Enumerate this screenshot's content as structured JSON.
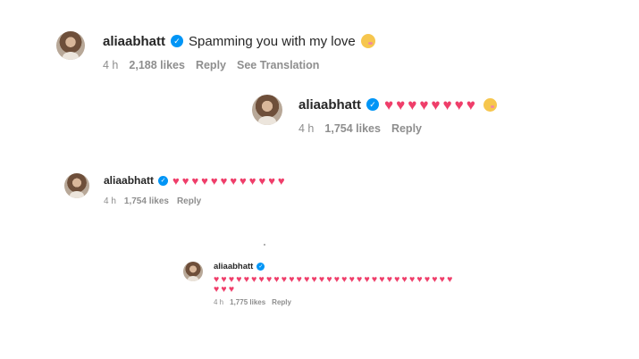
{
  "comments": [
    {
      "username": "aliaabhatt",
      "text": "Spamming you with my love",
      "emoji_trailing": "face-with-hearts-icon",
      "time": "4 h",
      "likes": "2,188 likes",
      "reply": "Reply",
      "translation": "See Translation"
    },
    {
      "username": "aliaabhatt",
      "hearts": 8,
      "emoji_trailing": "face-with-hearts-icon",
      "time": "4 h",
      "likes": "1,754 likes",
      "reply": "Reply"
    },
    {
      "username": "aliaabhatt",
      "hearts": 12,
      "time": "4 h",
      "likes": "1,754 likes",
      "reply": "Reply"
    },
    {
      "username": "aliaabhatt",
      "hearts": 35,
      "time": "4 h",
      "likes": "1,775 likes",
      "reply": "Reply"
    }
  ],
  "colors": {
    "verified": "#0095f6",
    "heart": "#ef3e6a",
    "meta": "#8e8e8e"
  }
}
